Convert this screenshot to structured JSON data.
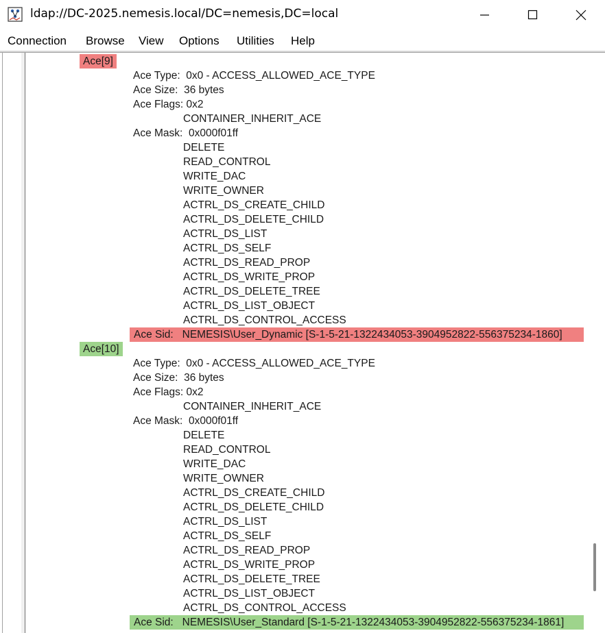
{
  "window": {
    "title": "ldap://DC-2025.nemesis.local/DC=nemesis,DC=local"
  },
  "menu": [
    "Connection",
    "Browse",
    "View",
    "Options",
    "Utilities",
    "Help"
  ],
  "colors": {
    "denied_highlight": "#f08080",
    "allowed_highlight": "#9ed48c"
  },
  "aces": [
    {
      "header": "Ace[9]",
      "highlight": "red",
      "type": "Ace Type:  0x0 - ACCESS_ALLOWED_ACE_TYPE",
      "size": "Ace Size:  36 bytes",
      "flags": "Ace Flags: 0x2",
      "flag_values": [
        "CONTAINER_INHERIT_ACE"
      ],
      "mask": "Ace Mask:  0x000f01ff",
      "rights": [
        "DELETE",
        "READ_CONTROL",
        "WRITE_DAC",
        "WRITE_OWNER",
        "ACTRL_DS_CREATE_CHILD",
        "ACTRL_DS_DELETE_CHILD",
        "ACTRL_DS_LIST",
        "ACTRL_DS_SELF",
        "ACTRL_DS_READ_PROP",
        "ACTRL_DS_WRITE_PROP",
        "ACTRL_DS_DELETE_TREE",
        "ACTRL_DS_LIST_OBJECT",
        "ACTRL_DS_CONTROL_ACCESS"
      ],
      "sid": "Ace Sid:   NEMESIS\\User_Dynamic [S-1-5-21-1322434053-3904952822-556375234-1860]"
    },
    {
      "header": "Ace[10]",
      "highlight": "green",
      "type": "Ace Type:  0x0 - ACCESS_ALLOWED_ACE_TYPE",
      "size": "Ace Size:  36 bytes",
      "flags": "Ace Flags: 0x2",
      "flag_values": [
        "CONTAINER_INHERIT_ACE"
      ],
      "mask": "Ace Mask:  0x000f01ff",
      "rights": [
        "DELETE",
        "READ_CONTROL",
        "WRITE_DAC",
        "WRITE_OWNER",
        "ACTRL_DS_CREATE_CHILD",
        "ACTRL_DS_DELETE_CHILD",
        "ACTRL_DS_LIST",
        "ACTRL_DS_SELF",
        "ACTRL_DS_READ_PROP",
        "ACTRL_DS_WRITE_PROP",
        "ACTRL_DS_DELETE_TREE",
        "ACTRL_DS_LIST_OBJECT",
        "ACTRL_DS_CONTROL_ACCESS"
      ],
      "sid": "Ace Sid:   NEMESIS\\User_Standard [S-1-5-21-1322434053-3904952822-556375234-1861]"
    }
  ]
}
